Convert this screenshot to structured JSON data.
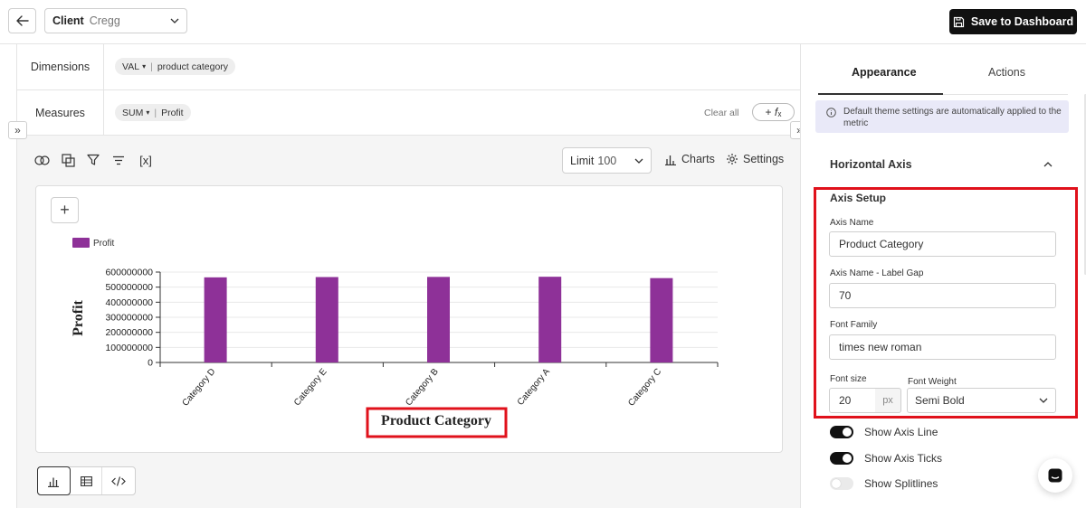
{
  "header": {
    "back_icon": "arrow-left-icon",
    "client_label": "Client",
    "client_value": "Cregg",
    "save_label": "Save to Dashboard"
  },
  "query": {
    "dimensions_label": "Dimensions",
    "dimension_pill": {
      "agg": "VAL",
      "field": "product category"
    },
    "measures_label": "Measures",
    "measure_pill": {
      "agg": "SUM",
      "field": "Profit"
    },
    "clear_all": "Clear all",
    "fx_symbol": "+ 𝑓ₓ"
  },
  "toolbar": {
    "limit_label": "Limit",
    "limit_value": "100",
    "charts_label": "Charts",
    "settings_label": "Settings"
  },
  "chart_data": {
    "type": "bar",
    "categories": [
      "Category D",
      "Category E",
      "Category B",
      "Category A",
      "Category C"
    ],
    "series": [
      {
        "name": "Profit",
        "values": [
          565000000,
          567000000,
          568000000,
          569000000,
          560000000
        ]
      }
    ],
    "ylim": [
      0,
      600000000
    ],
    "yticks": [
      "600000000",
      "500000000",
      "400000000",
      "300000000",
      "200000000",
      "100000000",
      "0"
    ],
    "ylabel": "Profit",
    "xlabel": "Product Category",
    "legend_position": "top-left",
    "color": "#8e3198",
    "grid": true
  },
  "right_panel": {
    "tabs": [
      "Appearance",
      "Actions"
    ],
    "info_text": "Default theme settings are automatically applied to the metric",
    "section_title": "Horizontal Axis",
    "axis_setup_title": "Axis Setup",
    "axis_name_label": "Axis Name",
    "axis_name_value": "Product Category",
    "label_gap_label": "Axis Name - Label Gap",
    "label_gap_value": "70",
    "font_family_label": "Font Family",
    "font_family_value": "times new roman",
    "font_size_label": "Font size",
    "font_size_value": "20",
    "font_size_unit": "px",
    "font_weight_label": "Font Weight",
    "font_weight_value": "Semi Bold",
    "toggles": [
      {
        "label": "Show Axis Line",
        "on": true
      },
      {
        "label": "Show Axis Ticks",
        "on": true
      },
      {
        "label": "Show Splitlines",
        "on": false
      }
    ]
  },
  "colors": {
    "highlight": "#e0111b",
    "bar": "#8e3198",
    "primary": "#111111"
  }
}
